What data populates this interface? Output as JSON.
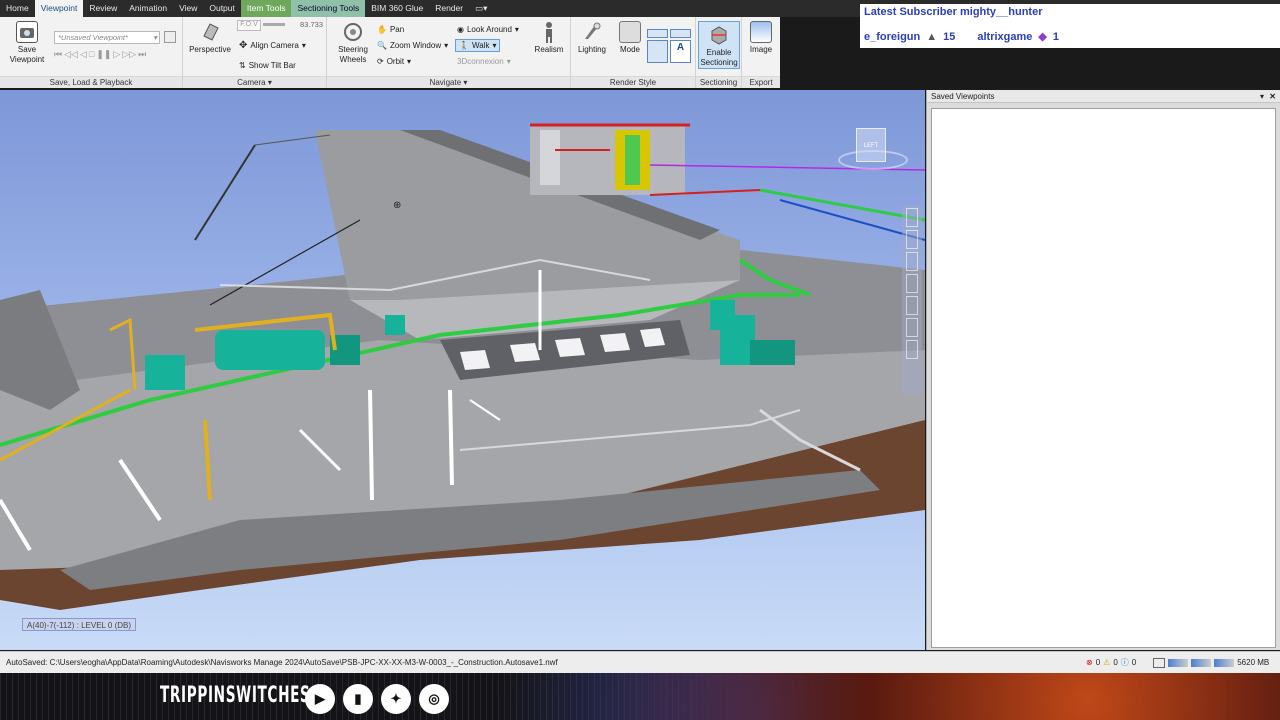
{
  "tabs": [
    {
      "label": "Home"
    },
    {
      "label": "Viewpoint",
      "active": true
    },
    {
      "label": "Review"
    },
    {
      "label": "Animation"
    },
    {
      "label": "View"
    },
    {
      "label": "Output"
    },
    {
      "label": "Item Tools",
      "context": "green"
    },
    {
      "label": "Sectioning Tools",
      "context": "teal"
    },
    {
      "label": "BIM 360 Glue"
    },
    {
      "label": "Render"
    }
  ],
  "ribbon": {
    "save_load": {
      "save_viewpoint": "Save\nViewpoint",
      "viewpoint_select": "*Unsaved Viewpoint*",
      "title": "Save, Load & Playback"
    },
    "camera": {
      "perspective": "Perspective",
      "fov_label": "F.O.V",
      "fov_value": "83.733",
      "align_camera": "Align Camera",
      "show_tilt_bar": "Show Tilt Bar",
      "title": "Camera"
    },
    "navigate": {
      "steering_wheels": "Steering\nWheels",
      "pan": "Pan",
      "zoom_window": "Zoom Window",
      "orbit": "Orbit",
      "look_around": "Look Around",
      "walk": "Walk",
      "connexion": "3Dconnexion",
      "realism": "Realism",
      "title": "Navigate"
    },
    "render_style": {
      "lighting": "Lighting",
      "mode": "Mode",
      "title": "Render Style"
    },
    "sectioning": {
      "enable": "Enable\nSectioning",
      "title": "Sectioning"
    },
    "export": {
      "image": "Image",
      "title": "Export"
    }
  },
  "stream_overlay": {
    "line1": "Latest Subscriber  mighty__hunter",
    "line2_a": "e_foreigun",
    "line2_a_count": "15",
    "line2_b": "altrixgame",
    "line2_b_count": "1"
  },
  "viewport": {
    "location_label": "A(40)-7(-112) : LEVEL 0 (DB)",
    "viewcube_face": "LEFT"
  },
  "saved_viewpoints": {
    "title": "Saved Viewpoints"
  },
  "status": {
    "autosave_text": "AutoSaved: C:\\Users\\eogha\\AppData\\Roaming\\Autodesk\\Navisworks Manage 2024\\AutoSave\\PSB-JPC-XX-XX-M3-W-0003_-_Construction.Autosave1.nwf",
    "err_count": "0",
    "warn_count": "0",
    "info_count": "0",
    "memory": "5620 MB"
  },
  "footer": {
    "brand": "TRIPPINSWITCHES"
  },
  "colors": {
    "accent_blue": "#1a4e8a",
    "pipe_green": "#2ecc40",
    "duct_teal": "#17b29a",
    "steel_yellow": "#e0b020",
    "subscriber_text": "#2a3fbf"
  }
}
